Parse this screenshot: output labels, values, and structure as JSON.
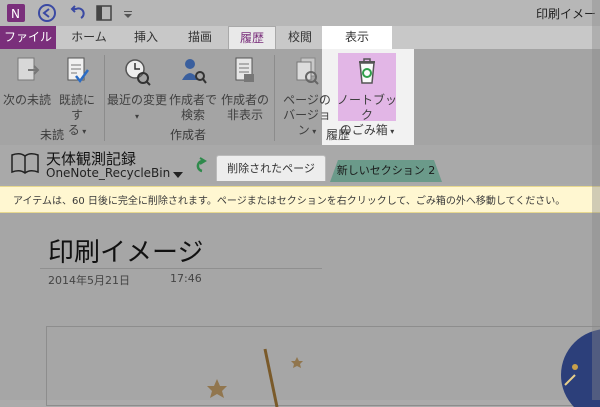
{
  "window": {
    "app_title": "印刷イメー"
  },
  "tabs": {
    "file": "ファイル",
    "home": "ホーム",
    "insert": "挿入",
    "draw": "描画",
    "history": "履歴",
    "review": "校閲",
    "view": "表示"
  },
  "ribbon": {
    "unread_group": "未読",
    "next_unread": "次の未読",
    "mark_read_line1": "既読にす",
    "mark_read_line2": "る",
    "author_group": "作成者",
    "recent_changes": "最近の変更",
    "find_by_author_line1": "作成者で",
    "find_by_author_line2": "検索",
    "hide_authors_line1": "作成者の",
    "hide_authors_line2": "非表示",
    "page_versions_line1": "ページの",
    "page_versions_line2": "バージョン",
    "notebook_recycle_line1": "ノートブック",
    "notebook_recycle_line2": "のごみ箱",
    "history_group": "履歴"
  },
  "notebook": {
    "name": "天体観測記録",
    "location": "OneNote_RecycleBin",
    "section_deleted": "削除されたページ",
    "section_new": "新しいセクション 2"
  },
  "info_bar": {
    "message": "アイテムは、60 日後に完全に削除されます。ページまたはセクションを右クリックして、ごみ箱の外へ移動してください。"
  },
  "page": {
    "title": "印刷イメージ",
    "date": "2014年5月21日",
    "time": "17:46"
  },
  "colors": {
    "brand": "#7a2f7b",
    "trash_highlight": "#e2b6e6",
    "info_bar": "#fff7d1",
    "section_new": "#6b9a8a"
  }
}
